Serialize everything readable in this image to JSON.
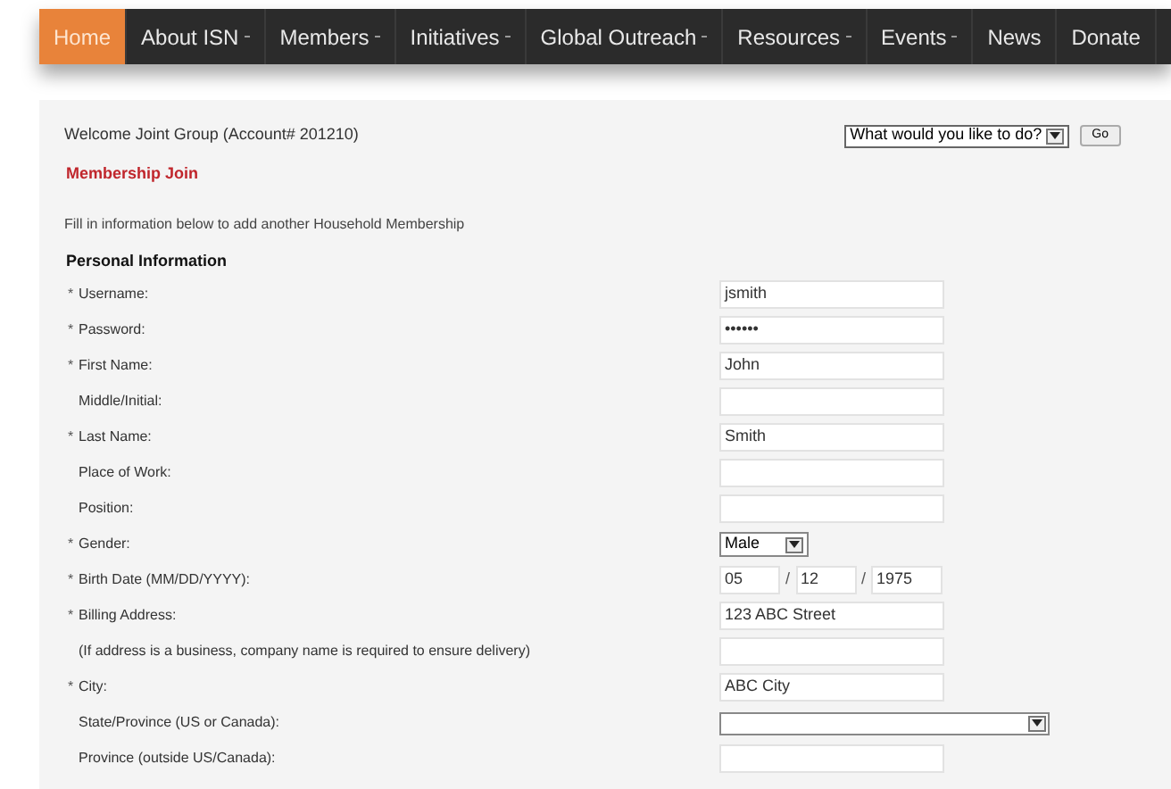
{
  "nav": [
    {
      "label": "Home",
      "selected": true,
      "dropdown": false
    },
    {
      "label": "About ISN",
      "selected": false,
      "dropdown": true
    },
    {
      "label": "Members",
      "selected": false,
      "dropdown": true
    },
    {
      "label": "Initiatives",
      "selected": false,
      "dropdown": true
    },
    {
      "label": "Global Outreach",
      "selected": false,
      "dropdown": true
    },
    {
      "label": "Resources",
      "selected": false,
      "dropdown": true
    },
    {
      "label": "Events",
      "selected": false,
      "dropdown": true
    },
    {
      "label": "News",
      "selected": false,
      "dropdown": false
    },
    {
      "label": "Donate",
      "selected": false,
      "dropdown": false
    }
  ],
  "welcome": "Welcome Joint Group (Account# 201210)",
  "action_select": {
    "value": "What would you like to do?"
  },
  "go_button": "Go",
  "page_title": "Membership Join",
  "intro": "Fill in information below to add another Household Membership",
  "section_title": "Personal Information",
  "fields": [
    {
      "label": "Username:",
      "required": true,
      "kind": "text",
      "value": "jsmith"
    },
    {
      "label": "Password:",
      "required": true,
      "kind": "password",
      "value": "••••••"
    },
    {
      "label": "First Name:",
      "required": true,
      "kind": "text",
      "value": "John"
    },
    {
      "label": "Middle/Initial:",
      "required": false,
      "kind": "text"
    },
    {
      "label": "Last Name:",
      "required": true,
      "kind": "text",
      "value": "Smith"
    },
    {
      "label": "Place of Work:",
      "required": false,
      "kind": "text"
    },
    {
      "label": "Position:",
      "required": false,
      "kind": "text"
    },
    {
      "label": "Gender:",
      "required": true,
      "kind": "select",
      "value": "Male"
    },
    {
      "label": "Birth Date (MM/DD/YYYY):",
      "required": true,
      "kind": "date",
      "parts": [
        "05",
        "12",
        "1975"
      ],
      "separator": "/"
    },
    {
      "label": "Billing Address:",
      "required": true,
      "kind": "text",
      "value": "123 ABC Street"
    },
    {
      "label": "(If address is a business, company name is required to ensure delivery)",
      "required": false,
      "kind": "text"
    },
    {
      "label": "City:",
      "required": true,
      "kind": "text",
      "value": "ABC City"
    },
    {
      "label": "State/Province (US or Canada):",
      "required": false,
      "kind": "wide-select"
    },
    {
      "label": "Province (outside US/Canada):",
      "required": false,
      "kind": "text"
    }
  ],
  "required_mark": "*"
}
